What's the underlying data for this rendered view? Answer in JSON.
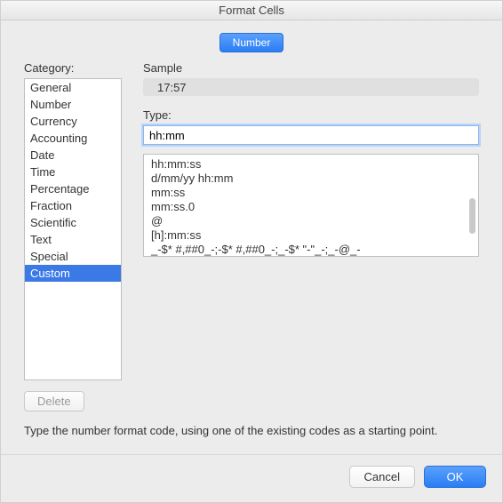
{
  "window": {
    "title": "Format Cells"
  },
  "tabs": {
    "number": "Number"
  },
  "category": {
    "label": "Category:",
    "items": [
      "General",
      "Number",
      "Currency",
      "Accounting",
      "Date",
      "Time",
      "Percentage",
      "Fraction",
      "Scientific",
      "Text",
      "Special",
      "Custom"
    ],
    "selected_index": 11
  },
  "sample": {
    "label": "Sample",
    "value": "17:57"
  },
  "type": {
    "label": "Type:",
    "value": "hh:mm"
  },
  "formats": {
    "items": [
      "hh:mm:ss",
      "d/mm/yy hh:mm",
      "mm:ss",
      "mm:ss.0",
      "@",
      "[h]:mm:ss",
      "_-$* #,##0_-;-$* #,##0_-;_-$* \"-\"_-;_-@_-"
    ]
  },
  "buttons": {
    "delete": "Delete",
    "cancel": "Cancel",
    "ok": "OK"
  },
  "hint": "Type the number format code, using one of the existing codes as a starting point."
}
